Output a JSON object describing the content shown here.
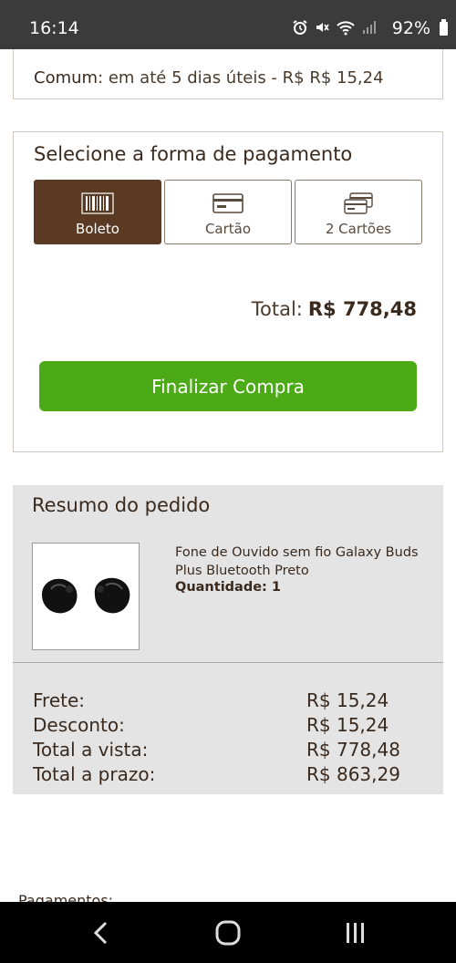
{
  "status_bar": {
    "time": "16:14",
    "battery": "92%"
  },
  "shipping": {
    "option_name": "Comum",
    "option_detail": ": em até 5 dias úteis - R$ R$ 15,24"
  },
  "payment": {
    "title": "Selecione a forma de pagamento",
    "options": [
      {
        "label": "Boleto",
        "icon": "barcode-icon",
        "selected": true
      },
      {
        "label": "Cartão",
        "icon": "credit-card-icon",
        "selected": false
      },
      {
        "label": "2 Cartões",
        "icon": "two-cards-icon",
        "selected": false
      }
    ],
    "total_label": "Total:",
    "total_value": "R$ 778,48",
    "finalize_label": "Finalizar Compra"
  },
  "summary": {
    "title": "Resumo do pedido",
    "product": {
      "name": "Fone de Ouvido sem fio Galaxy Buds Plus Bluetooth Preto",
      "quantity": "Quantidade: 1"
    },
    "rows": [
      {
        "label": "Frete:",
        "value": "R$ 15,24"
      },
      {
        "label": "Desconto:",
        "value": "R$ 15,24"
      },
      {
        "label": "Total a vista:",
        "value": "R$ 778,48"
      },
      {
        "label": "Total a prazo:",
        "value": "R$ 863,29"
      }
    ]
  },
  "footer_cut_text": "Pagamentos:",
  "colors": {
    "brand_brown": "#5a3a22",
    "finalize_green": "#4caa16",
    "summary_bg": "#e4e4e4"
  }
}
